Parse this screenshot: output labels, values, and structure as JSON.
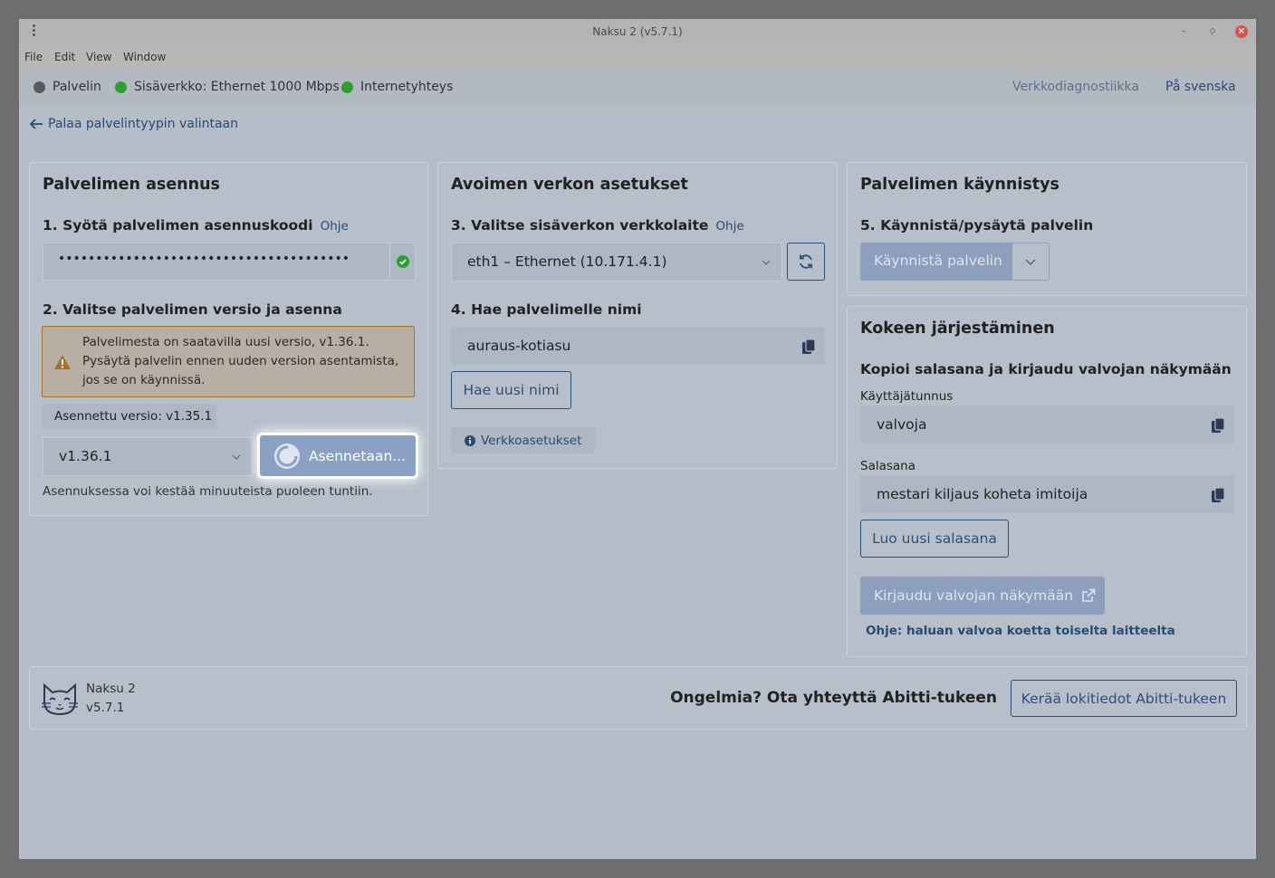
{
  "window": {
    "title": "Naksu 2 (v5.7.1)",
    "menu": [
      "File",
      "Edit",
      "View",
      "Window"
    ]
  },
  "status": {
    "server": "Palvelin",
    "lan": "Sisäverkko: Ethernet 1000 Mbps",
    "internet": "Internetyhteys",
    "diag_link": "Verkkodiagnostiikka",
    "lang_link": "På svenska",
    "colors": {
      "server": "#5a5a5a",
      "lan": "#2e9e2e",
      "internet": "#2e9e2e"
    }
  },
  "back_link": "Palaa palvelintyypin valintaan",
  "install": {
    "title": "Palvelimen asennus",
    "step1": "1. Syötä palvelimen asennuskoodi",
    "help": "Ohje",
    "code_value": "•••••••••••••••••••••••••••••••••••••••",
    "step2": "2. Valitse palvelimen versio ja asenna",
    "warning": "Palvelimesta on saatavilla uusi versio, v1.36.1. Pysäytä palvelin ennen uuden version asentamista, jos se on käynnissä.",
    "installed_version": "Asennettu versio: v1.35.1",
    "selected_version": "v1.36.1",
    "install_button": "Asennetaan...",
    "note": "Asennuksessa voi kestää minuuteista puoleen tuntiin."
  },
  "network": {
    "title": "Avoimen verkon asetukset",
    "step3": "3. Valitse sisäverkon verkkolaite",
    "help": "Ohje",
    "device": "eth1 – Ethernet (10.171.4.1)",
    "step4": "4. Hae palvelimelle nimi",
    "server_name": "auraus-kotiasu",
    "new_name_button": "Hae uusi nimi",
    "settings_button": "Verkkoasetukset"
  },
  "startup": {
    "title": "Palvelimen käynnistys",
    "step5": "5. Käynnistä/pysäytä palvelin",
    "start_button": "Käynnistä palvelin"
  },
  "exam": {
    "title": "Kokeen järjestäminen",
    "subtitle": "Kopioi salasana ja kirjaudu valvojan näkymään",
    "username_label": "Käyttäjätunnus",
    "username": "valvoja",
    "password_label": "Salasana",
    "password": "mestari kiljaus koheta imitoija",
    "new_password_button": "Luo uusi salasana",
    "login_button": "Kirjaudu valvojan näkymään",
    "help_link": "Ohje: haluan valvoa koetta toiselta laitteelta"
  },
  "footer": {
    "app_name": "Naksu 2",
    "version": "v5.7.1",
    "problem_text": "Ongelmia? Ota yhteyttä Abitti-tukeen",
    "logs_button": "Kerää lokitiedot Abitti-tukeen"
  }
}
